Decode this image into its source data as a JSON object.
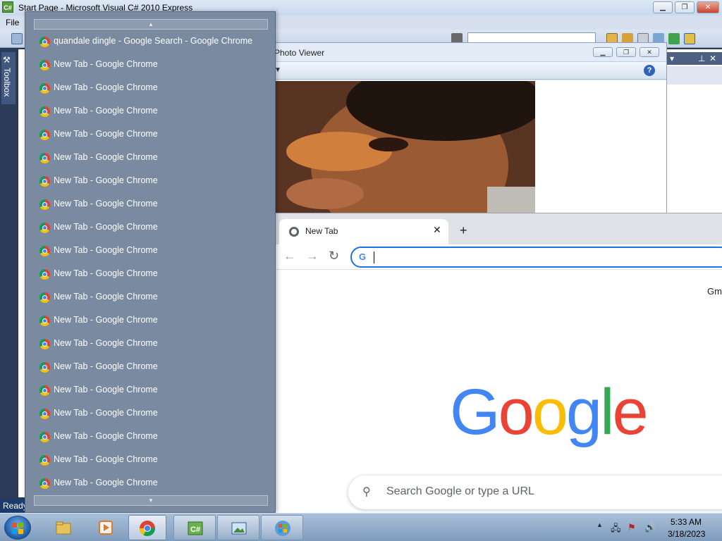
{
  "vs": {
    "title": "Start Page - Microsoft Visual C# 2010 Express",
    "icon_text": "C#",
    "menu": {
      "file": "File"
    },
    "toolbox_label": "Toolbox",
    "status": "Ready",
    "controls": {
      "minimize": "▁",
      "restore": "❐",
      "close": "✕"
    }
  },
  "photo_viewer": {
    "title": "Photo Viewer",
    "help": "?",
    "controls": {
      "minimize": "▁",
      "restore": "❐",
      "close": "✕"
    }
  },
  "window_list": {
    "items": [
      {
        "label": "quandale dingle - Google Search - Google Chrome"
      },
      {
        "label": "New Tab - Google Chrome"
      },
      {
        "label": "New Tab - Google Chrome"
      },
      {
        "label": "New Tab - Google Chrome"
      },
      {
        "label": "New Tab - Google Chrome"
      },
      {
        "label": "New Tab - Google Chrome"
      },
      {
        "label": "New Tab - Google Chrome"
      },
      {
        "label": "New Tab - Google Chrome"
      },
      {
        "label": "New Tab - Google Chrome"
      },
      {
        "label": "New Tab - Google Chrome"
      },
      {
        "label": "New Tab - Google Chrome"
      },
      {
        "label": "New Tab - Google Chrome"
      },
      {
        "label": "New Tab - Google Chrome"
      },
      {
        "label": "New Tab - Google Chrome"
      },
      {
        "label": "New Tab - Google Chrome"
      },
      {
        "label": "New Tab - Google Chrome"
      },
      {
        "label": "New Tab - Google Chrome"
      },
      {
        "label": "New Tab - Google Chrome"
      },
      {
        "label": "New Tab - Google Chrome"
      },
      {
        "label": "New Tab - Google Chrome"
      }
    ]
  },
  "chrome": {
    "tab_title": "New Tab",
    "tab_close": "✕",
    "new_tab": "+",
    "back": "←",
    "forward": "→",
    "reload": "↻",
    "omnibox_icon": "G",
    "gmail_link": "Gm",
    "logo": {
      "letters": [
        "G",
        "o",
        "o",
        "g",
        "l",
        "e"
      ],
      "colors": [
        "#4285f4",
        "#ea4335",
        "#fbbc05",
        "#4285f4",
        "#34a853",
        "#ea4335"
      ]
    },
    "search_placeholder": "Search Google or type a URL"
  },
  "taskbar": {
    "tray_expand": "▲",
    "clock_time": "5:33 AM",
    "clock_date": "3/18/2023"
  }
}
